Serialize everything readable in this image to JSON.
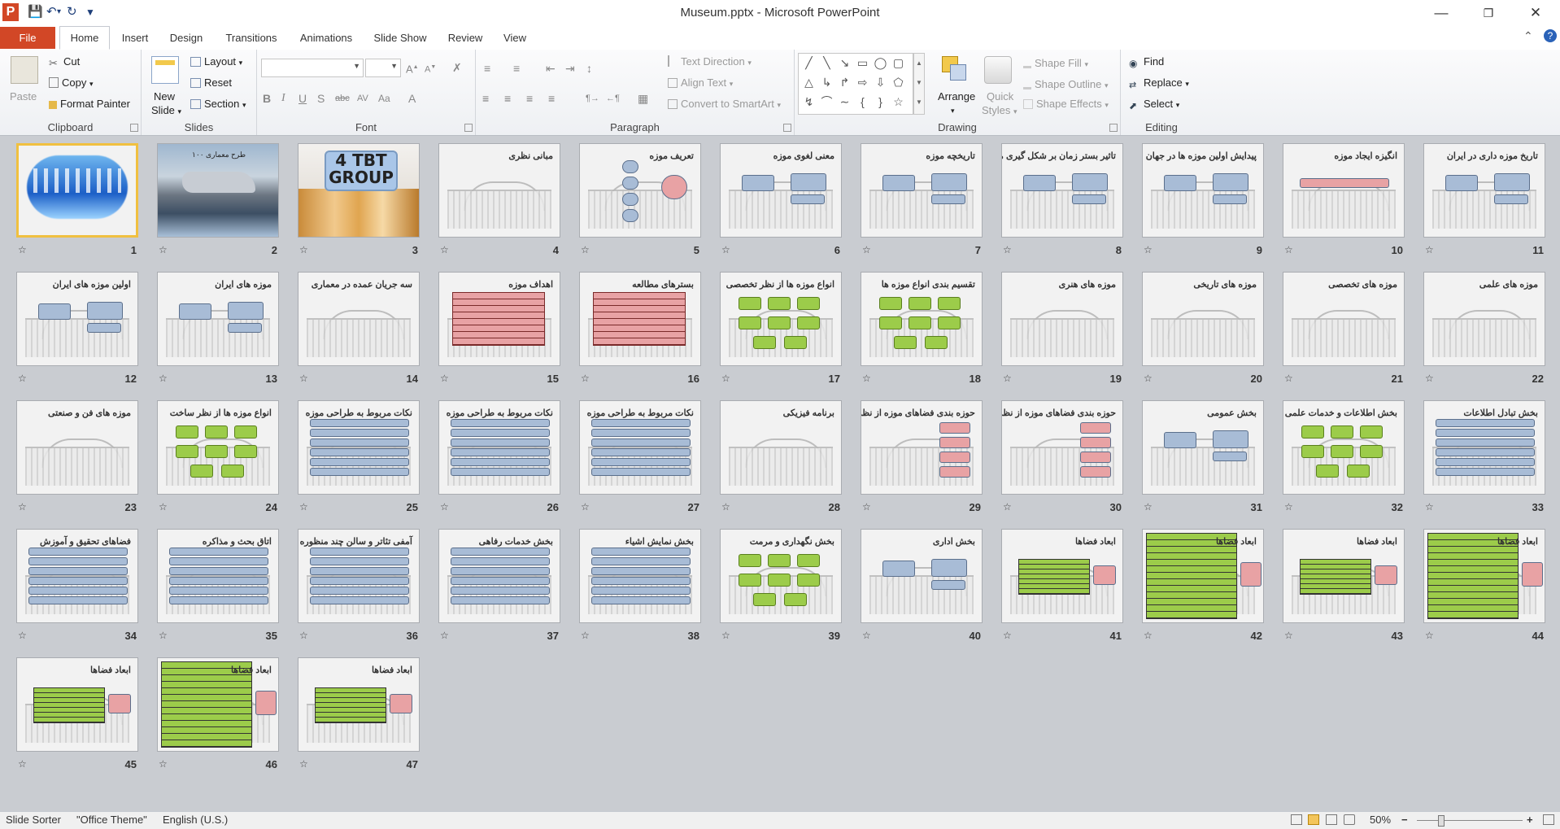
{
  "window": {
    "title": "Museum.pptx - Microsoft PowerPoint",
    "logo_letter": "P"
  },
  "tabs": {
    "file": "File",
    "items": [
      "Home",
      "Insert",
      "Design",
      "Transitions",
      "Animations",
      "Slide Show",
      "Review",
      "View"
    ],
    "active": "Home"
  },
  "ribbon": {
    "clipboard": {
      "label": "Clipboard",
      "paste": "Paste",
      "cut": "Cut",
      "copy": "Copy",
      "format_painter": "Format Painter"
    },
    "slides": {
      "label": "Slides",
      "new_slide_1": "New",
      "new_slide_2": "Slide",
      "layout": "Layout",
      "reset": "Reset",
      "section": "Section"
    },
    "font": {
      "label": "Font",
      "font_name": "",
      "font_size": ""
    },
    "paragraph": {
      "label": "Paragraph",
      "text_direction": "Text Direction",
      "align_text": "Align Text",
      "convert_smartart": "Convert to SmartArt"
    },
    "drawing": {
      "label": "Drawing",
      "arrange": "Arrange",
      "quick_styles_1": "Quick",
      "quick_styles_2": "Styles",
      "shape_fill": "Shape Fill",
      "shape_outline": "Shape Outline",
      "shape_effects": "Shape Effects"
    },
    "editing": {
      "label": "Editing",
      "find": "Find",
      "replace": "Replace",
      "select": "Select"
    }
  },
  "slides": [
    {
      "n": "1",
      "title": "",
      "kind": "calligraphy"
    },
    {
      "n": "2",
      "title": "طرح معماری ۱۰۰",
      "kind": "photo"
    },
    {
      "n": "3",
      "title": "4 TBT GROUP",
      "kind": "group"
    },
    {
      "n": "4",
      "title": "مبانی نظری",
      "kind": "plain"
    },
    {
      "n": "5",
      "title": "تعریف موزه",
      "kind": "circles"
    },
    {
      "n": "6",
      "title": "معنی لغوی موزه",
      "kind": "boxes"
    },
    {
      "n": "7",
      "title": "تاریخچه موزه",
      "kind": "boxes"
    },
    {
      "n": "8",
      "title": "تاثیر بستر زمان بر شکل گیری موزه ها",
      "kind": "boxes"
    },
    {
      "n": "9",
      "title": "پیدایش اولین موزه ها در جهان",
      "kind": "boxes"
    },
    {
      "n": "10",
      "title": "انگیزه ایجاد موزه",
      "kind": "redbox"
    },
    {
      "n": "11",
      "title": "تاریخ موزه داری در ایران",
      "kind": "boxes"
    },
    {
      "n": "12",
      "title": "اولین موزه های ایران",
      "kind": "boxes"
    },
    {
      "n": "13",
      "title": "موزه های ایران",
      "kind": "boxes"
    },
    {
      "n": "14",
      "title": "سه جریان عمده در معماری",
      "kind": "plain"
    },
    {
      "n": "15",
      "title": "اهداف موزه",
      "kind": "table-red"
    },
    {
      "n": "16",
      "title": "بسترهای مطالعه",
      "kind": "table-red"
    },
    {
      "n": "17",
      "title": "انواع موزه ها از نظر تخصصی",
      "kind": "green"
    },
    {
      "n": "18",
      "title": "تقسیم بندی انواع موزه ها",
      "kind": "green"
    },
    {
      "n": "19",
      "title": "موزه های هنری",
      "kind": "plain"
    },
    {
      "n": "20",
      "title": "موزه های تاریخی",
      "kind": "plain"
    },
    {
      "n": "21",
      "title": "موزه های تخصصی",
      "kind": "plain"
    },
    {
      "n": "22",
      "title": "موزه های علمی",
      "kind": "plain"
    },
    {
      "n": "23",
      "title": "موزه های فن و صنعتی",
      "kind": "plain"
    },
    {
      "n": "24",
      "title": "انواع موزه ها از نظر ساخت",
      "kind": "green"
    },
    {
      "n": "25",
      "title": "نکات مربوط به طراحی موزه",
      "kind": "bars"
    },
    {
      "n": "26",
      "title": "نکات مربوط به طراحی موزه",
      "kind": "bars"
    },
    {
      "n": "27",
      "title": "نکات مربوط به طراحی موزه",
      "kind": "bars"
    },
    {
      "n": "28",
      "title": "برنامه فیزیکی",
      "kind": "plain"
    },
    {
      "n": "29",
      "title": "حوزه بندی فضاهای موزه از نظر میزان",
      "kind": "redlist"
    },
    {
      "n": "30",
      "title": "حوزه بندی فضاهای موزه از نظر عملکرد",
      "kind": "redlist"
    },
    {
      "n": "31",
      "title": "بخش عمومی",
      "kind": "boxes"
    },
    {
      "n": "32",
      "title": "بخش اطلاعات و خدمات علمی",
      "kind": "green"
    },
    {
      "n": "33",
      "title": "بخش تبادل اطلاعات",
      "kind": "bars"
    },
    {
      "n": "34",
      "title": "فضاهای تحقیق و آموزش",
      "kind": "bars"
    },
    {
      "n": "35",
      "title": "اتاق بحث و مذاکره",
      "kind": "bars"
    },
    {
      "n": "36",
      "title": "آمفی تئاتر و سالن چند منظوره",
      "kind": "bars"
    },
    {
      "n": "37",
      "title": "بخش خدمات رفاهی",
      "kind": "bars"
    },
    {
      "n": "38",
      "title": "بخش نمایش اشیاء",
      "kind": "bars"
    },
    {
      "n": "39",
      "title": "بخش نگهداری و مرمت",
      "kind": "green"
    },
    {
      "n": "40",
      "title": "بخش اداری",
      "kind": "boxes"
    },
    {
      "n": "41",
      "title": "ابعاد فضاها",
      "kind": "table-green"
    },
    {
      "n": "42",
      "title": "ابعاد فضاها",
      "kind": "table-green-big"
    },
    {
      "n": "43",
      "title": "ابعاد فضاها",
      "kind": "table-green"
    },
    {
      "n": "44",
      "title": "ابعاد فضاها",
      "kind": "table-green-big"
    },
    {
      "n": "45",
      "title": "ابعاد فضاها",
      "kind": "table-green"
    },
    {
      "n": "46",
      "title": "ابعاد فضاها",
      "kind": "table-green-big"
    },
    {
      "n": "47",
      "title": "ابعاد فضاها",
      "kind": "table-green"
    }
  ],
  "status": {
    "view": "Slide Sorter",
    "theme": "\"Office Theme\"",
    "language": "English (U.S.)",
    "zoom": "50%"
  },
  "colors": {
    "file_tab": "#d24726",
    "sorter_bg": "#c9ccd1",
    "selection": "#f0c040",
    "box_blue": "#a8bcd6",
    "box_green": "#9ccc4a",
    "box_red": "#e8a2a4"
  }
}
